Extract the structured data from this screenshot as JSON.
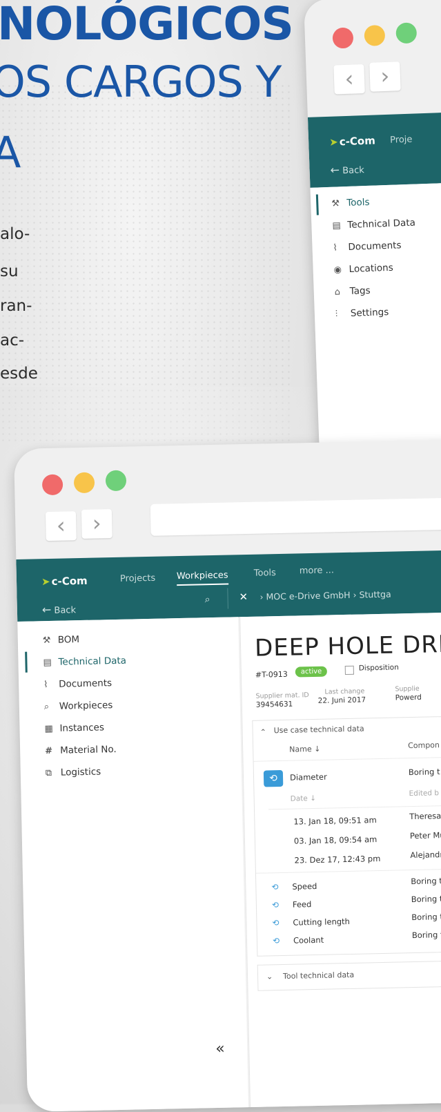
{
  "headline": {
    "line1": "NOLÓGICOS",
    "line2": "OS CARGOS Y",
    "line3": "A",
    "body": [
      "alo-",
      "su",
      "ran-",
      "ac-",
      "esde"
    ]
  },
  "colors": {
    "brand_teal": "#1d6569",
    "headline_blue": "#1a56a6",
    "accent_green": "#6cc24a",
    "link_blue": "#3a9bd8"
  },
  "back_window": {
    "app": {
      "logo": "c-Com",
      "nav_partial": "Proje"
    },
    "back_label": "Back",
    "sidebar": [
      {
        "label": "Tools",
        "icon": "wrench-icon",
        "active": true
      },
      {
        "label": "Technical Data",
        "icon": "clipboard-icon"
      },
      {
        "label": "Documents",
        "icon": "paperclip-icon"
      },
      {
        "label": "Locations",
        "icon": "pin-icon"
      },
      {
        "label": "Tags",
        "icon": "tag-icon"
      },
      {
        "label": "Settings",
        "icon": "sliders-icon"
      }
    ]
  },
  "front_window": {
    "app": {
      "logo": "c-Com"
    },
    "nav": [
      "Projects",
      "Workpieces",
      "Tools",
      "more ..."
    ],
    "active_nav": "Workpieces",
    "back_label": "Back",
    "breadcrumb": {
      "root": "MOC e-Drive GmbH",
      "next": "Stuttga"
    },
    "sidebar": [
      {
        "label": "BOM",
        "icon": "wrench-icon"
      },
      {
        "label": "Technical Data",
        "icon": "clipboard-icon",
        "active": true
      },
      {
        "label": "Documents",
        "icon": "paperclip-icon"
      },
      {
        "label": "Workpieces",
        "icon": "workpiece-search-icon"
      },
      {
        "label": "Instances",
        "icon": "instances-icon"
      },
      {
        "label": "Material No.",
        "icon": "hash-icon"
      },
      {
        "label": "Logistics",
        "icon": "logistics-icon"
      }
    ],
    "collapse_label": "«",
    "page": {
      "title": "DEEP HOLE DRILL",
      "id": "#T-0913",
      "status": "active",
      "disposition_label": "Disposition",
      "meta": [
        {
          "label": "Supplier mat. ID",
          "value": "39454631"
        },
        {
          "label": "Last change",
          "value": "22. Juni 2017"
        },
        {
          "label": "Supplie",
          "value": "Powerd"
        }
      ]
    },
    "use_case_panel": {
      "title": "Use case technical data",
      "columns": {
        "name": "Name ↓",
        "component": "Compon"
      },
      "rows": [
        {
          "name": "Diameter",
          "component": "Boring t",
          "expanded": true
        },
        {
          "name": "Speed",
          "component": "Boring t"
        },
        {
          "name": "Feed",
          "component": "Boring t"
        },
        {
          "name": "Cutting length",
          "component": "Boring t"
        },
        {
          "name": "Coolant",
          "component": "Boring t"
        }
      ],
      "history": {
        "columns": {
          "date": "Date ↓",
          "edited_by": "Edited b"
        },
        "entries": [
          {
            "date": "13. Jan 18, 09:51 am",
            "by": "Theresa"
          },
          {
            "date": "03. Jan 18, 09:54 am",
            "by": "Peter Mu"
          },
          {
            "date": "23. Dez 17, 12:43 pm",
            "by": "Alejandr"
          }
        ]
      }
    },
    "tool_panel": {
      "title": "Tool technical data"
    }
  }
}
